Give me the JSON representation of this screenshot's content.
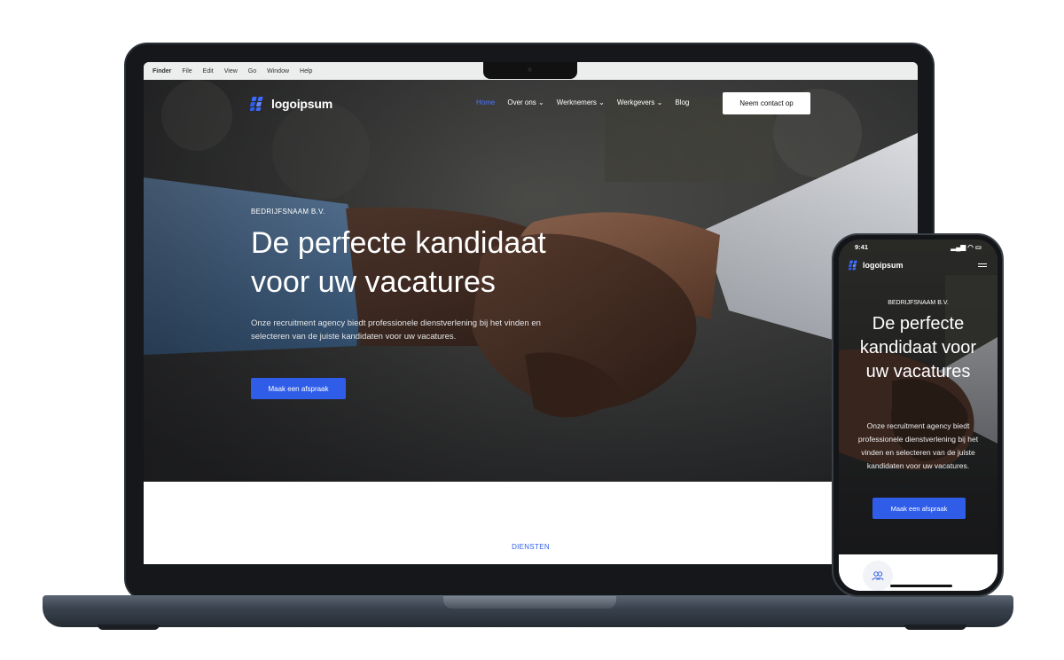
{
  "mac_menubar": {
    "items": [
      "Finder",
      "File",
      "Edit",
      "View",
      "Go",
      "Window",
      "Help"
    ]
  },
  "site": {
    "logo_text": "logoipsum",
    "logo_mark": "™",
    "nav": {
      "items": [
        "Home",
        "Over ons ⌄",
        "Werknemers ⌄",
        "Werkgevers ⌄",
        "Blog"
      ],
      "cta": "Neem contact op"
    },
    "hero": {
      "eyebrow": "BEDRIJFSNAAM B.V.",
      "headline_line1": "De perfecte kandidaat",
      "headline_line2": "voor uw vacatures",
      "subtext": "Onze recruitment agency biedt professionele dienstverlening bij het vinden en selecteren van de juiste kandidaten voor uw vacatures.",
      "cta": "Maak een afspraak"
    },
    "services_label": "DIENSTEN"
  },
  "phone": {
    "time": "9:41",
    "status_icons": "▂▄▆ ◠ ▭",
    "hero": {
      "eyebrow": "BEDRIJFSNAAM B.V.",
      "headline": "De perfecte kandidaat voor uw vacatures",
      "subtext": "Onze recruitment agency biedt professionele dienstverlening bij het vinden en selecteren van de juiste kandidaten voor uw vacatures.",
      "cta": "Maak een afspraak"
    }
  },
  "colors": {
    "accent": "#2f5de8",
    "nav_active": "#4d72ff",
    "device_frame": "#15171b",
    "base": "#3a434e"
  },
  "icons": [
    "logo-mark-icon",
    "chevron-down-icon",
    "hamburger-menu-icon",
    "chat-users-icon"
  ]
}
